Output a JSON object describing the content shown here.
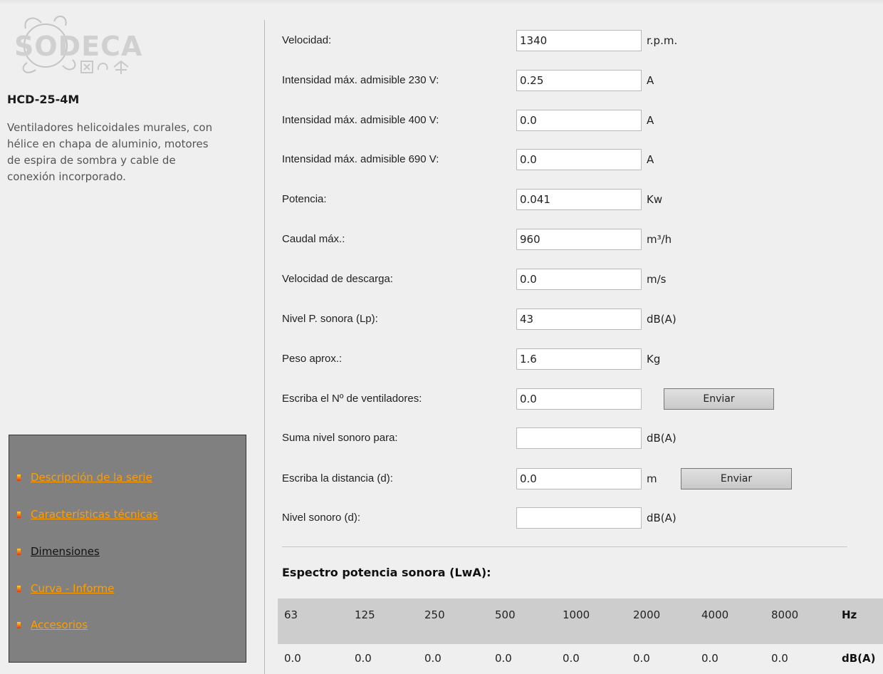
{
  "brand": {
    "logo_text": "SODECA"
  },
  "product": {
    "code": "HCD-25-4M",
    "description": "Ventiladores helicoidales murales, con hélice en chapa de aluminio, motores de espira de sombra y cable de conexión incorporado."
  },
  "menu": [
    {
      "label": "Descripción de la serie",
      "active": false
    },
    {
      "label": "Características técnicas",
      "active": false
    },
    {
      "label": "Dimensiones",
      "active": true
    },
    {
      "label": "Curva - Informe",
      "active": false
    },
    {
      "label": "Accesorios",
      "active": false
    }
  ],
  "form": [
    {
      "label": "Velocidad:",
      "value": "1340",
      "unit": "r.p.m."
    },
    {
      "label": "Intensidad máx. admisible 230 V:",
      "value": "0.25",
      "unit": "A"
    },
    {
      "label": "Intensidad máx. admisible 400 V:",
      "value": "0.0",
      "unit": "A"
    },
    {
      "label": "Intensidad máx. admisible 690 V:",
      "value": "0.0",
      "unit": "A"
    },
    {
      "label": "Potencia:",
      "value": "0.041",
      "unit": "Kw"
    },
    {
      "label": "Caudal máx.:",
      "value": "960",
      "unit": "m³/h"
    },
    {
      "label": "Velocidad de descarga:",
      "value": "0.0",
      "unit": "m/s"
    },
    {
      "label": "Nivel P. sonora (Lp):",
      "value": "43",
      "unit": "dB(A)"
    },
    {
      "label": "Peso aprox.:",
      "value": "1.6",
      "unit": "Kg"
    },
    {
      "label": "Escriba el Nº de ventiladores:",
      "value": "0.0",
      "unit": "",
      "button": "Enviar"
    },
    {
      "label": "Suma nivel sonoro para:",
      "value": "",
      "unit": "dB(A)"
    },
    {
      "label": "Escriba la distancia (d):",
      "value": "0.0",
      "unit": "m",
      "button": "Enviar"
    },
    {
      "label": "Nivel sonoro (d):",
      "value": "",
      "unit": "dB(A)"
    }
  ],
  "spectrum": {
    "title": "Espectro potencia sonora (LwA):",
    "frequencies": [
      "63",
      "125",
      "250",
      "500",
      "1000",
      "2000",
      "4000",
      "8000"
    ],
    "freq_unit": "Hz",
    "values": [
      "0.0",
      "0.0",
      "0.0",
      "0.0",
      "0.0",
      "0.0",
      "0.0",
      "0.0"
    ],
    "value_unit": "dB(A)"
  },
  "colors": {
    "menu_link": "#ff9d00",
    "menu_bg": "#808080",
    "page_bg": "#efefef"
  }
}
